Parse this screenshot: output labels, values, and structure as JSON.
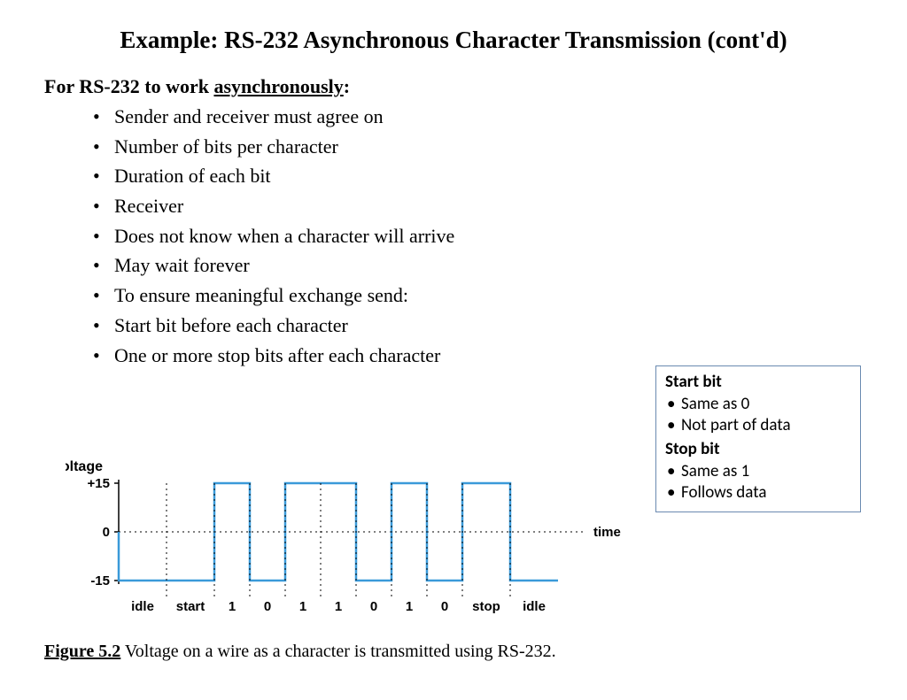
{
  "title": "Example: RS-232 Asynchronous Character Transmission (cont'd)",
  "intro_prefix": "For RS-232 to work ",
  "intro_underlined": "asynchronously",
  "intro_suffix": ":",
  "bullets": [
    "Sender and receiver must agree on",
    "Number of bits per character",
    "Duration of each bit",
    "Receiver",
    "Does not know when a character will arrive",
    "May wait forever",
    "To ensure meaningful exchange send:",
    "Start bit before each character",
    "One or more stop bits after each character"
  ],
  "sidebox": {
    "start_header": "Start bit",
    "start_items": [
      "Same as 0",
      "Not part of data"
    ],
    "stop_header": "Stop bit",
    "stop_items": [
      "Same as 1",
      "Follows data"
    ]
  },
  "caption": {
    "label": "Figure 5.2",
    "text": "  Voltage on a wire as a character is transmitted using RS-232."
  },
  "chart_data": {
    "type": "line",
    "title": "",
    "xlabel": "time",
    "ylabel": "voltage",
    "ylim": [
      -15,
      15
    ],
    "y_ticks": [
      -15,
      0,
      15
    ],
    "x_categories": [
      "idle",
      "start",
      "1",
      "0",
      "1",
      "1",
      "0",
      "1",
      "0",
      "stop",
      "idle"
    ],
    "x_widths": [
      54,
      54,
      40,
      40,
      40,
      40,
      40,
      40,
      40,
      54,
      54
    ],
    "values": [
      -15,
      -15,
      15,
      -15,
      15,
      15,
      -15,
      15,
      -15,
      15,
      -15
    ],
    "line_color": "#3a9ad9"
  }
}
